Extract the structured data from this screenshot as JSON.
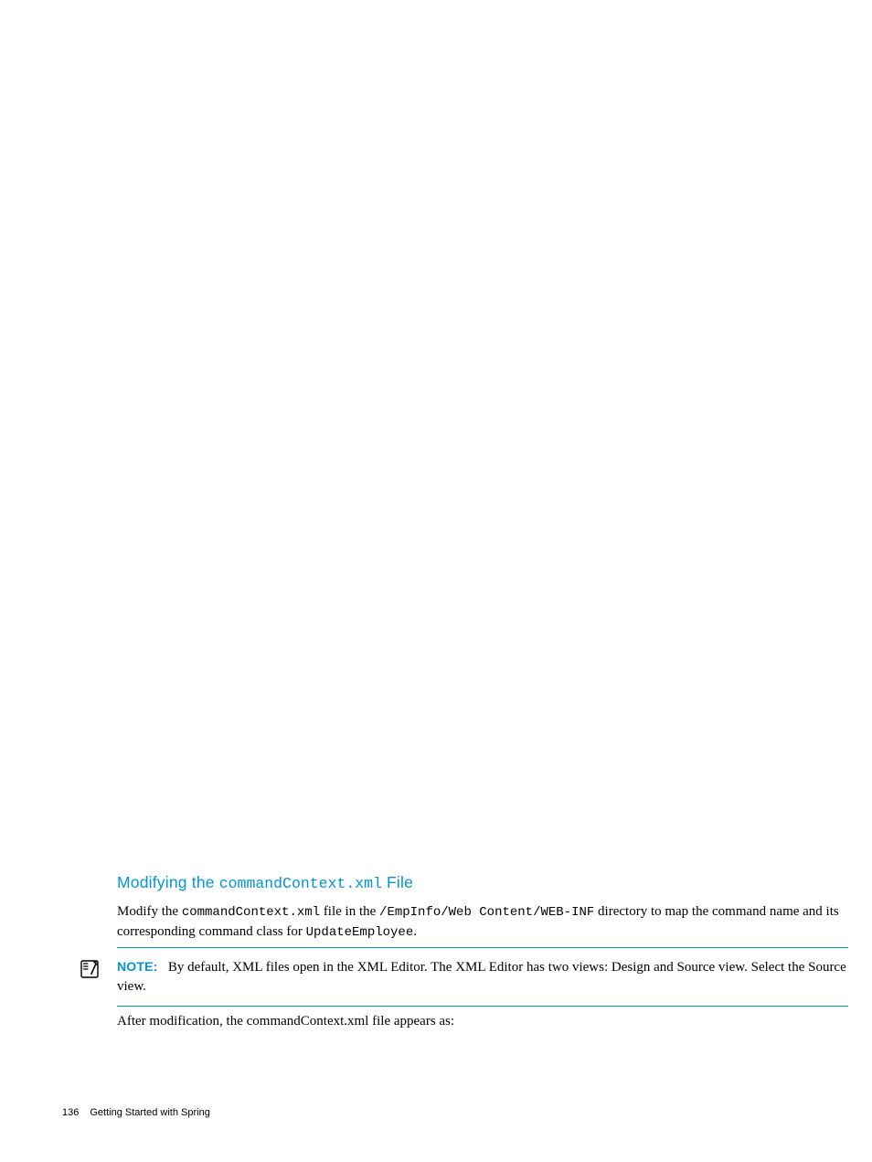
{
  "heading": {
    "prefix": "Modifying the ",
    "code": "commandContext.xml",
    "suffix": " File"
  },
  "para1": {
    "t1": "Modify the ",
    "c1": "commandContext.xml",
    "t2": " file in the ",
    "c2": "/EmpInfo/Web Content/WEB-INF",
    "t3": " directory to map the command name and its corresponding command class for ",
    "c3": "UpdateEmployee",
    "t4": "."
  },
  "note": {
    "label": "NOTE:",
    "text": "By default, XML files open in the XML Editor. The XML Editor has two views: Design and Source view. Select the Source view."
  },
  "para2": {
    "t1": "After modification, the ",
    "c1": "commandContext.xml",
    "t2": " file appears as:"
  },
  "footer": {
    "page": "136",
    "title": "Getting Started with Spring"
  }
}
